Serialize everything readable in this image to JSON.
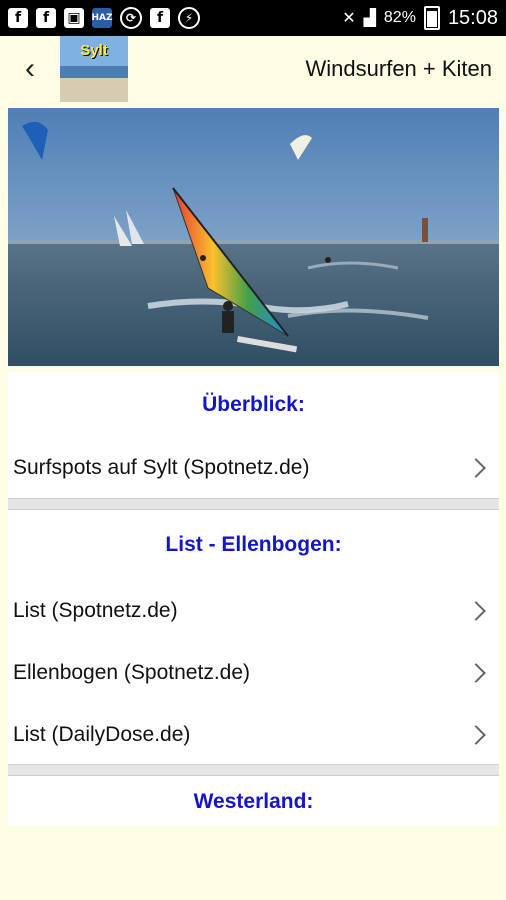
{
  "status_bar": {
    "left_icons": [
      "facebook-icon",
      "facebook-icon",
      "image-icon",
      "haz-app-icon",
      "sync-icon",
      "facebook-icon",
      "messenger-icon"
    ],
    "battery": "82%",
    "time": "15:08"
  },
  "app_bar": {
    "back_icon": "chevron-left-icon",
    "logo_text": "Sylt",
    "title": "Windsurfen + Kiten"
  },
  "sections": [
    {
      "header": "Überblick:",
      "items": [
        "Surfspots auf Sylt (Spotnetz.de)"
      ]
    },
    {
      "header": "List - Ellenbogen:",
      "items": [
        "List (Spotnetz.de)",
        "Ellenbogen (Spotnetz.de)",
        "List (DailyDose.de)"
      ]
    },
    {
      "header": "Westerland:",
      "items": []
    }
  ],
  "colors": {
    "header": "#1515c8",
    "background": "#fdfde3"
  }
}
